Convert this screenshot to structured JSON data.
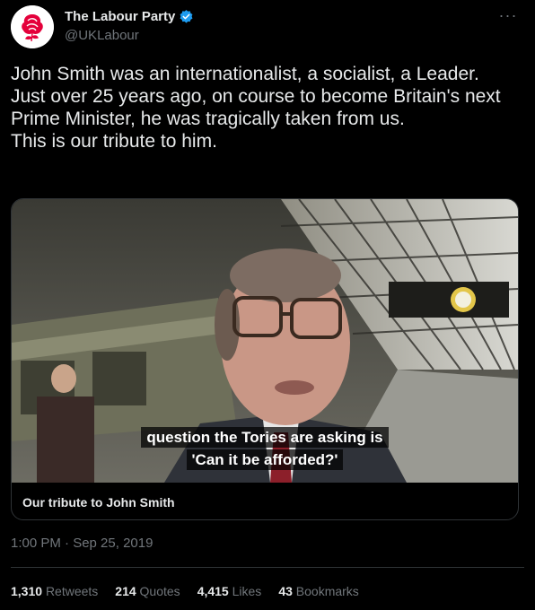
{
  "author": {
    "display_name": "The Labour Party",
    "handle": "@UKLabour",
    "verified": true,
    "avatar_icon": "labour-rose-icon",
    "brand_color": "#e4003b"
  },
  "tweet": {
    "text": "John Smith was an internationalist, a socialist, a Leader.\nJust over 25 years ago, on course to become Britain's next Prime Minister, he was tragically taken from us.\nThis is our tribute to him.",
    "timestamp": "1:00 PM · Sep 25, 2019"
  },
  "media": {
    "subtitle_line1": "question the Tories are asking is",
    "subtitle_line2": "'Can it be afforded?'",
    "caption": "Our tribute to John Smith"
  },
  "stats": {
    "retweets_count": "1,310",
    "retweets_label": "Retweets",
    "quotes_count": "214",
    "quotes_label": "Quotes",
    "likes_count": "4,415",
    "likes_label": "Likes",
    "bookmarks_count": "43",
    "bookmarks_label": "Bookmarks"
  }
}
